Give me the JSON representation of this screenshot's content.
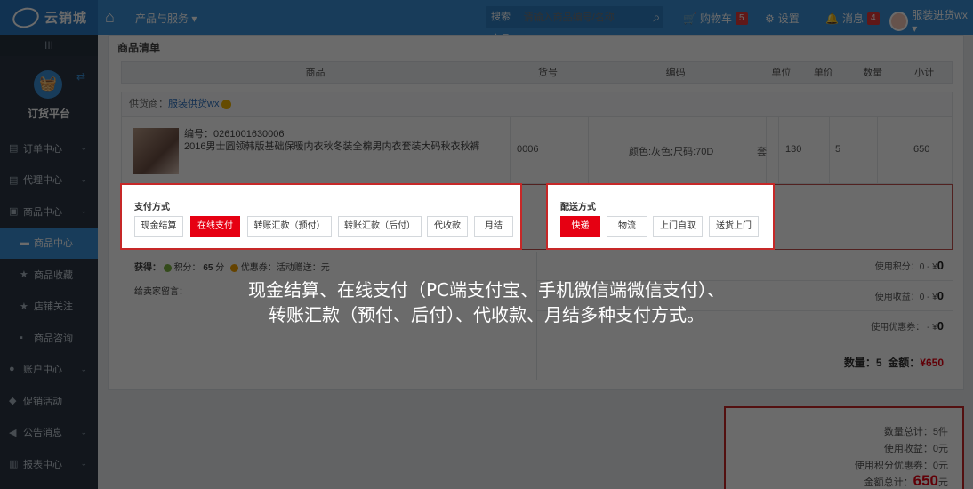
{
  "topbar": {
    "brand": "云销城",
    "menu": "产品与服务 ▾",
    "search_scope": "搜索商品 ▾",
    "search_placeholder": "请输入商品编号/名称",
    "cart_label": "购物车",
    "cart_count": "5",
    "settings_label": "设置",
    "messages_label": "消息",
    "messages_count": "4",
    "user_name": "服装进货wx ▾"
  },
  "sidebar": {
    "toggle": "III",
    "platform_title": "订货平台",
    "items": [
      {
        "label": "订单中心",
        "icon": "order-icon"
      },
      {
        "label": "代理中心",
        "icon": "agent-icon"
      },
      {
        "label": "商品中心",
        "icon": "goods-icon"
      },
      {
        "label": "商品中心",
        "icon": "goods-list-icon"
      },
      {
        "label": "商品收藏",
        "icon": "star-icon"
      },
      {
        "label": "店铺关注",
        "icon": "star-icon"
      },
      {
        "label": "商品咨询",
        "icon": "chat-icon"
      },
      {
        "label": "账户中心",
        "icon": "user-icon"
      },
      {
        "label": "促销活动",
        "icon": "tag-icon"
      },
      {
        "label": "公告消息",
        "icon": "megaphone-icon"
      },
      {
        "label": "报表中心",
        "icon": "chart-icon"
      }
    ]
  },
  "main": {
    "section_title": "商品清单",
    "columns": [
      "商品",
      "货号",
      "编码",
      "单位",
      "单价",
      "数量",
      "小计"
    ],
    "supplier_label": "供货商：",
    "supplier_name": "服装供货wx",
    "product": {
      "code_line": "编号：0261001630006",
      "name": "2016男士圆领韩版基础保暖内衣秋冬装全棉男内衣套装大码秋衣秋裤",
      "sku": "0006",
      "spec": "颜色:灰色;尺码:70D",
      "unit": "套",
      "price": "130",
      "qty": "5",
      "subtotal": "650"
    },
    "payment": {
      "title": "支付方式",
      "options": [
        "现金结算",
        "在线支付",
        "转账汇款（预付）",
        "转账汇款（后付）",
        "代收款",
        "月结"
      ],
      "selected": "在线支付"
    },
    "delivery": {
      "title": "配送方式",
      "options": [
        "快递",
        "物流",
        "上门自取",
        "送货上门"
      ],
      "selected": "快递"
    },
    "gain": {
      "label": "获得：",
      "points_label": "积分：",
      "points_value": "65",
      "points_unit": "分",
      "coupon_label": "优惠券：活动赠送：元"
    },
    "note_label": "给卖家留言：",
    "right": {
      "points_used": "使用积分：0 - ¥",
      "points_used_val": "0",
      "income_used": "使用收益：0 - ¥",
      "income_used_val": "0",
      "coupon_used": "使用优惠券： - ¥",
      "coupon_used_val": "0",
      "qty_label": "数量：5",
      "amount_label": "金额：",
      "amount_value": "¥650"
    }
  },
  "summary": {
    "qty_total": "数量总计：5件",
    "income": "使用收益：0元",
    "points_coupon": "使用积分优惠券：0元",
    "amount_label": "金额总计：",
    "amount_value": "650",
    "amount_unit": "元"
  },
  "caption": {
    "line1": "现金结算、在线支付（PC端支付宝、手机微信端微信支付）、",
    "line2": "转账汇款（预付、后付）、代收款、月结多种支付方式。"
  },
  "colors": {
    "primary": "#3a8fd6",
    "sidebar": "#2b3643",
    "accent": "#e60012"
  }
}
